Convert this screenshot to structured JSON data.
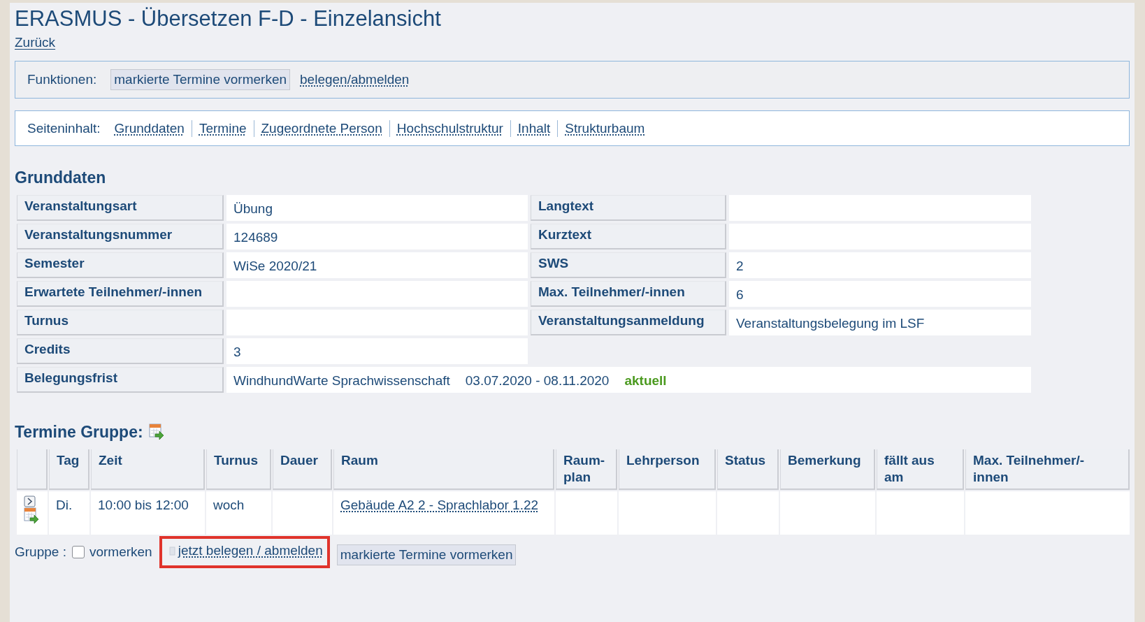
{
  "title": "ERASMUS - Übersetzen F-D - Einzelansicht",
  "back_link": "Zurück",
  "functions": {
    "label": "Funktionen:",
    "items": [
      {
        "kind": "button",
        "label": "markierte Termine vormerken"
      },
      {
        "kind": "link",
        "label": "belegen/abmelden"
      }
    ]
  },
  "page_contents": {
    "label": "Seiteninhalt:",
    "links": [
      "Grunddaten",
      "Termine",
      "Zugeordnete Person",
      "Hochschulstruktur",
      "Inhalt",
      "Strukturbaum"
    ]
  },
  "basic_data": {
    "heading": "Grunddaten",
    "rows": [
      {
        "cells": [
          {
            "kind": "label",
            "text": "Veranstaltungsart"
          },
          {
            "kind": "value",
            "text": "Übung"
          },
          {
            "kind": "label",
            "text": "Langtext"
          },
          {
            "kind": "value"
          }
        ]
      },
      {
        "cells": [
          {
            "kind": "label",
            "text": "Veranstaltungsnummer"
          },
          {
            "kind": "value",
            "text": "124689"
          },
          {
            "kind": "label",
            "text": "Kurztext"
          },
          {
            "kind": "value"
          }
        ]
      },
      {
        "cells": [
          {
            "kind": "label",
            "text": "Semester"
          },
          {
            "kind": "value",
            "text": "WiSe 2020/21"
          },
          {
            "kind": "label",
            "text": "SWS"
          },
          {
            "kind": "value",
            "text": "2"
          }
        ]
      },
      {
        "cells": [
          {
            "kind": "label",
            "text": "Erwartete Teilnehmer/-innen"
          },
          {
            "kind": "value"
          },
          {
            "kind": "label",
            "text": "Max. Teilnehmer/-innen"
          },
          {
            "kind": "value",
            "text": "6"
          }
        ]
      },
      {
        "cells": [
          {
            "kind": "label",
            "text": "Turnus"
          },
          {
            "kind": "value"
          },
          {
            "kind": "label",
            "text": "Veranstaltungsanmeldung"
          },
          {
            "kind": "value",
            "text": "Veranstaltungsbelegung im LSF"
          }
        ]
      },
      {
        "cells": [
          {
            "kind": "label",
            "text": "Credits"
          },
          {
            "kind": "value",
            "text": "3"
          }
        ]
      },
      {
        "cells": [
          {
            "kind": "label",
            "text": "Belegungsfrist"
          },
          {
            "kind": "wide",
            "parts": [
              {
                "kind": "plain",
                "text": "WindhundWarte Sprachwissenschaft"
              },
              {
                "kind": "plain",
                "text": "03.07.2020 - 08.11.2020"
              },
              {
                "kind": "status",
                "text": "aktuell"
              }
            ]
          }
        ]
      }
    ]
  },
  "dates": {
    "heading": "Termine Gruppe:",
    "columns": [
      "Tag",
      "Zeit",
      "Turnus",
      "Dauer",
      "Raum",
      "Raum-\nplan",
      "Lehrperson",
      "Status",
      "Bemerkung",
      "fällt aus\nam",
      "Max. Teilnehmer/-\ninnen"
    ],
    "rows": [
      {
        "day": "Di.",
        "time": "10:00 bis 12:00",
        "frequency": "woch",
        "room": "Gebäude A2 2 - Sprachlabor 1.22"
      }
    ]
  },
  "group": {
    "label": "Gruppe :",
    "checked": false,
    "checkbox_label": "vormerken",
    "link": "jetzt belegen / abmelden",
    "highlighted": true,
    "button": "markierte Termine vormerken"
  }
}
